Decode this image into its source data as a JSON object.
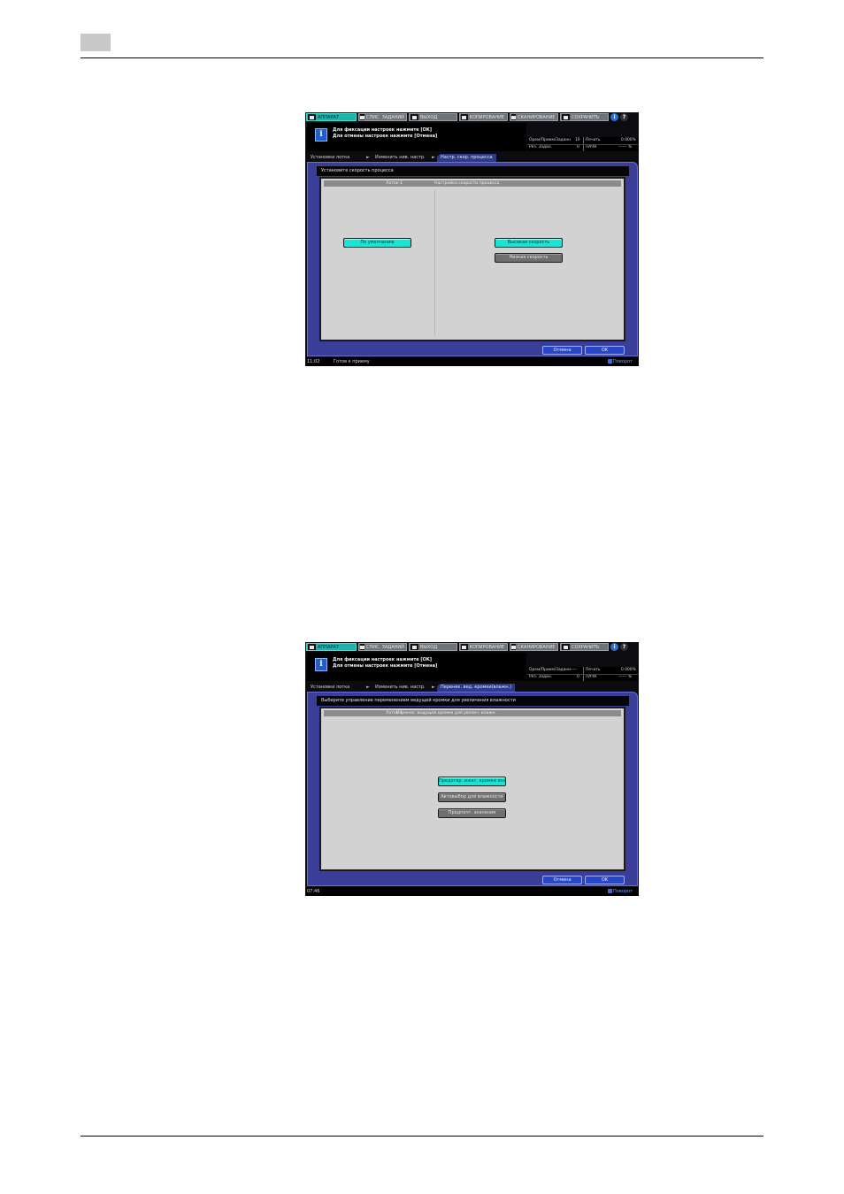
{
  "screens": [
    {
      "tabs": [
        "АППАРАТ",
        "СПИС. ЗАДАНИЙ",
        "ВЫХОД",
        "КОПИРОВАНИЕ",
        "СКАНИРОВАНИЕ",
        "СОХРАНИТЬ"
      ],
      "message": [
        "Для фиксации настроек нажмите [OK]",
        "Для отмены настроек нажмите [Отмена]"
      ],
      "status": {
        "r1c1": "Орем/Прием/Заданн",
        "r1c2": "10",
        "r1c3": "Печать",
        "r1c4": "0.000%",
        "r2c1": "Рез. Задан.",
        "r2c2": "0",
        "r2c3": "ПАЧК",
        "r2c4": "------ %"
      },
      "breadcrumb": [
        "Установки лотка",
        "Изменить нив. настр.",
        "Настр. скор. процесса"
      ],
      "headline": "Установите скорость процесса",
      "panel_header": [
        "Лоток 1",
        "Настройка скорости процесса"
      ],
      "options_left": [
        {
          "label": "По умолчанию",
          "selected": true
        }
      ],
      "options_right": [
        {
          "label": "Высокая скорость",
          "selected": true
        },
        {
          "label": "Низкая скорость",
          "selected": false
        }
      ],
      "cancel": "Отмена",
      "ok": "OK",
      "footer": {
        "time": "11:02",
        "status": "Готов к приему",
        "right": "Поворот"
      }
    },
    {
      "tabs": [
        "АППАРАТ",
        "СПИС. ЗАДАНИЙ",
        "ВЫХОД",
        "КОПИРОВАНИЕ",
        "СКАНИРОВАНИЕ",
        "СОХРАНИТЬ"
      ],
      "message": [
        "Для фиксации настроек нажмите [OK]",
        "Для отмены настроек нажмите [Отмена]"
      ],
      "status": {
        "r1c1": "Орем/Прием/Заданн",
        "r1c2": "------",
        "r1c3": "Печать",
        "r1c4": "0.000%",
        "r2c1": "Рез. Задан.",
        "r2c2": "0",
        "r2c3": "ПАЧК",
        "r2c4": "------ %"
      },
      "breadcrumb": [
        "Установки лотка",
        "Изменить нив. настр.",
        "Перенек. вед. кромки(влажн.)"
      ],
      "headline": "Выберите управление переменением ведущей кромки для увеличения влажности",
      "panel_header": [
        "Лоток 1",
        "Перенек. ведущей кромки для увелич. влажн."
      ],
      "options": [
        {
          "label": "Предотвр. ижат. кромки изобр",
          "selected": true
        },
        {
          "label": "Автовыбор для влажности",
          "selected": false
        },
        {
          "label": "Предпочт. значения",
          "selected": false
        }
      ],
      "cancel": "Отмена",
      "ok": "OK",
      "footer": {
        "time": "07:46",
        "status": "",
        "right": "Поворот"
      }
    }
  ]
}
